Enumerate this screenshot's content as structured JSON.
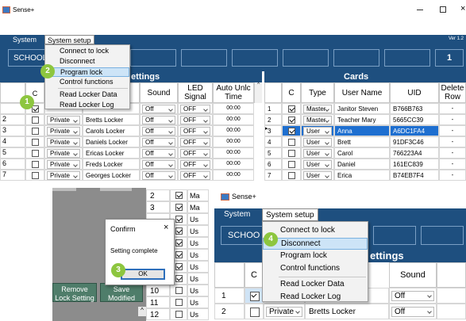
{
  "app": {
    "title": "Sense+",
    "version": "Ver 1.2"
  },
  "menubar": {
    "system": "System",
    "system_setup": "System setup"
  },
  "school_label": "SCHOOL",
  "top_right_number": "1",
  "setup_menu_top": {
    "items": [
      "Connect to lock",
      "Disconnect",
      "Program lock",
      "Control functions",
      "Read Locker Data",
      "Read Locker Log"
    ],
    "highlighted": "Program lock"
  },
  "settings_header": "ettings",
  "cards_header": "Cards",
  "locker_table": {
    "headers": {
      "c": "C",
      "sound": "Sound",
      "led": "LED Signal",
      "auto": "Auto Unlc Time"
    },
    "rows": [
      {
        "num": "",
        "checked": true,
        "type": "",
        "name": "",
        "sound": "Off",
        "led": "OFF",
        "time": "00:00"
      },
      {
        "num": "2",
        "checked": false,
        "type": "Private",
        "name": "Bretts Locker",
        "sound": "Off",
        "led": "OFF",
        "time": "00:00"
      },
      {
        "num": "3",
        "checked": false,
        "type": "Private",
        "name": "Carols Locker",
        "sound": "Off",
        "led": "OFF",
        "time": "00:00"
      },
      {
        "num": "4",
        "checked": false,
        "type": "Private",
        "name": "Daniels Locker",
        "sound": "Off",
        "led": "OFF",
        "time": "00:00"
      },
      {
        "num": "5",
        "checked": false,
        "type": "Private",
        "name": "Ericas Locker",
        "sound": "Off",
        "led": "OFF",
        "time": "00:00"
      },
      {
        "num": "6",
        "checked": false,
        "type": "Private",
        "name": "Freds Locker",
        "sound": "Off",
        "led": "OFF",
        "time": "00:00"
      },
      {
        "num": "7",
        "checked": false,
        "type": "Private",
        "name": "Georges Locker",
        "sound": "Off",
        "led": "OFF",
        "time": "00:00"
      }
    ]
  },
  "cards_table": {
    "headers": {
      "c": "C",
      "type": "Type",
      "user": "User Name",
      "uid": "UID",
      "delete": "Delete Row"
    },
    "rows": [
      {
        "num": "1",
        "checked": true,
        "type": "Master",
        "user": "Janitor Steven",
        "uid": "B766B763",
        "del": "-"
      },
      {
        "num": "2",
        "checked": true,
        "type": "Master",
        "user": "Teacher Mary",
        "uid": "5665CC39",
        "del": "-"
      },
      {
        "num": "3",
        "checked": true,
        "type": "User",
        "user": "Anna",
        "uid": "A6DC1FA4",
        "del": "-"
      },
      {
        "num": "4",
        "checked": false,
        "type": "User",
        "user": "Brett",
        "uid": "91DF3C46",
        "del": "-"
      },
      {
        "num": "5",
        "checked": false,
        "type": "User",
        "user": "Carol",
        "uid": "766223A4",
        "del": "-"
      },
      {
        "num": "6",
        "checked": false,
        "type": "User",
        "user": "Daniel",
        "uid": "161EC839",
        "del": "-"
      },
      {
        "num": "7",
        "checked": false,
        "type": "User",
        "user": "Erica",
        "uid": "B74EB7F4",
        "del": "-"
      }
    ]
  },
  "badges": {
    "b1": "1",
    "b2": "2",
    "b3": "3",
    "b4": "4"
  },
  "confirm_dialog": {
    "title": "Confirm",
    "message": "Setting complete",
    "ok": "OK"
  },
  "bottom_left": {
    "remove_button": "Remove Lock Setting",
    "save_button": "Save Modified",
    "rows": [
      {
        "num": "2",
        "type": "Ma"
      },
      {
        "num": "3",
        "type": "Ma"
      },
      {
        "num": "",
        "type": "Us"
      },
      {
        "num": "",
        "type": "Us"
      },
      {
        "num": "",
        "type": "Us"
      },
      {
        "num": "",
        "type": "Us"
      },
      {
        "num": "",
        "type": "Us"
      },
      {
        "num": "",
        "type": "Us"
      },
      {
        "num": "10",
        "type": "Us"
      },
      {
        "num": "11",
        "type": "Us"
      },
      {
        "num": "12",
        "type": "Us"
      }
    ]
  },
  "bottom_right": {
    "title": "Sense+",
    "menu_system": "System",
    "menu_setup": "System setup",
    "school": "SCHOO",
    "settings_header": "ettings",
    "c_header": "C",
    "sound_header": "Sound",
    "menu_items": [
      "Connect to lock",
      "Disconnect",
      "Program lock",
      "Control functions",
      "Read Locker Data",
      "Read Locker Log"
    ],
    "highlighted": "Disconnect",
    "rows": [
      {
        "num": "1",
        "type": "",
        "name": "",
        "sound": "Off"
      },
      {
        "num": "2",
        "type": "Private",
        "name": "Bretts Locker",
        "sound": "Off"
      }
    ]
  }
}
